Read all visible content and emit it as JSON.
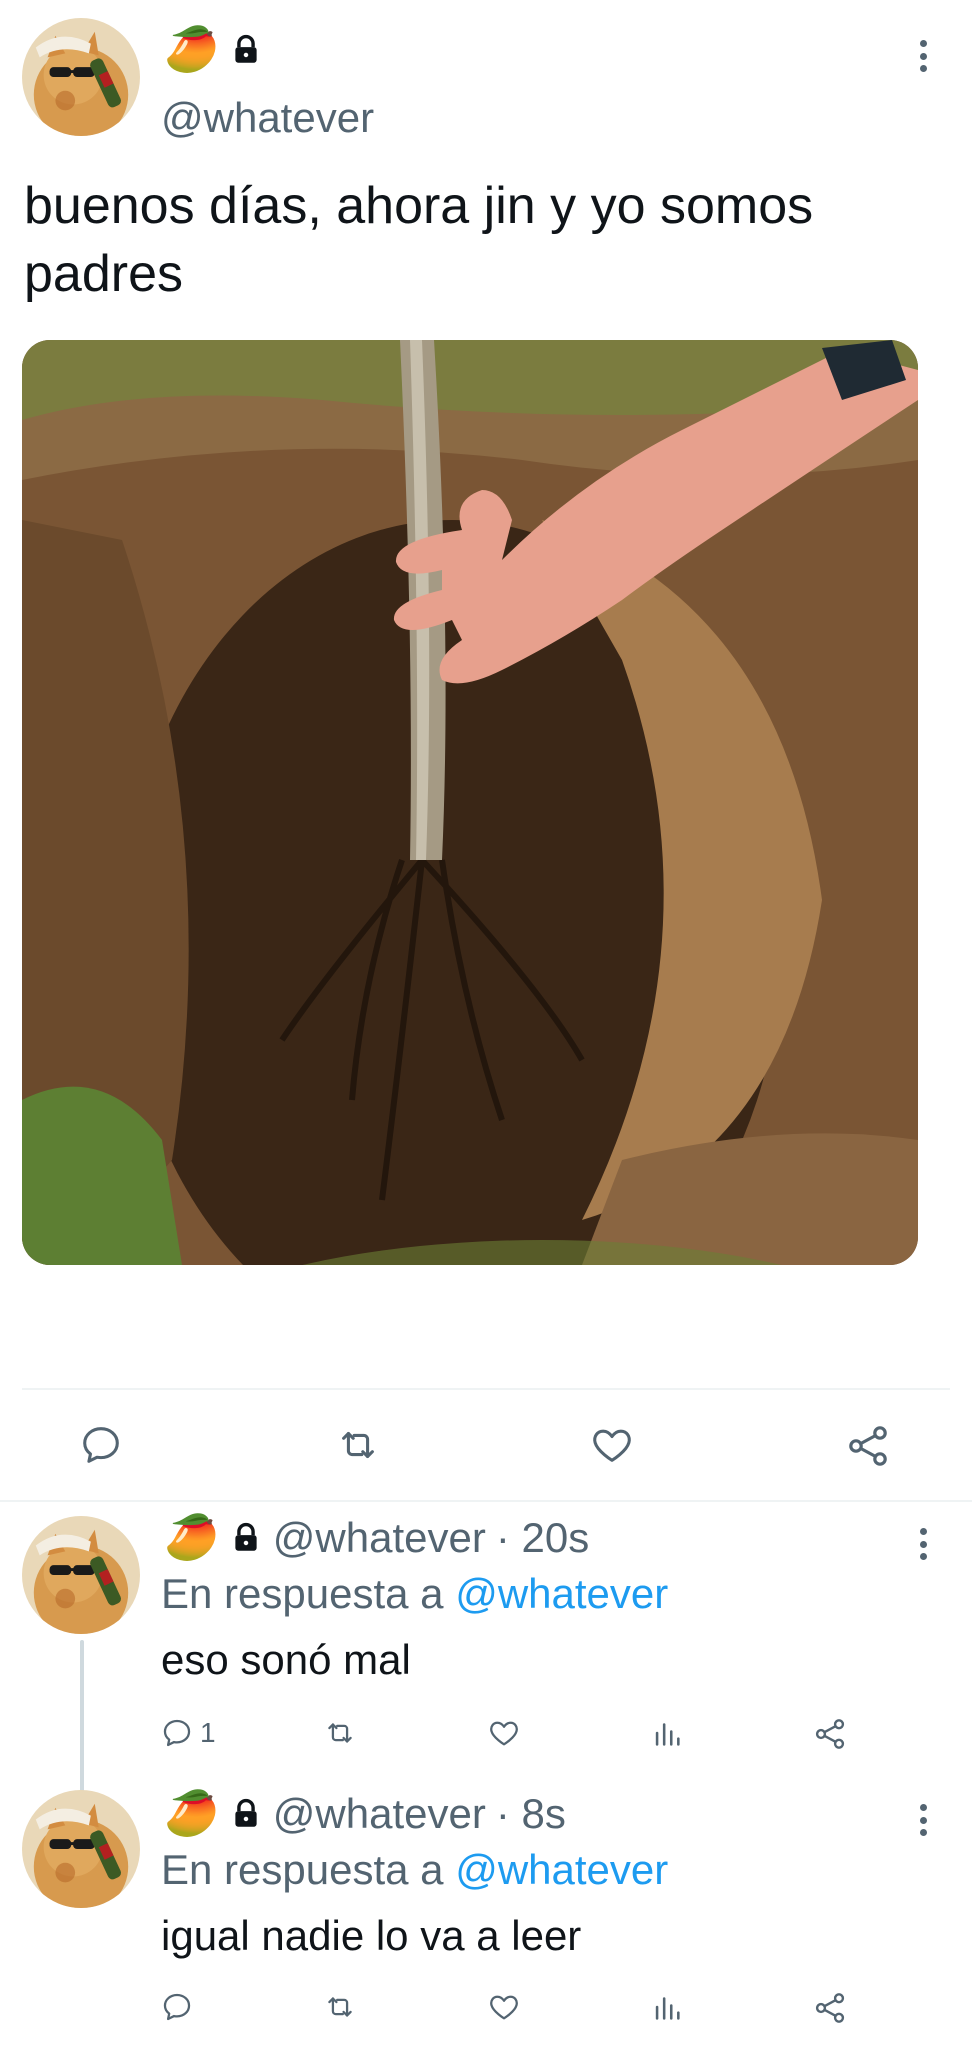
{
  "main_post": {
    "emoji": "🥭",
    "handle": "@whatever",
    "text": "buenos días, ahora jin y yo somos padres"
  },
  "replies": [
    {
      "emoji": "🥭",
      "handle": "@whatever",
      "time": "· 20s",
      "reply_to_label": "En respuesta a",
      "reply_to_handle": "@whatever",
      "text": "eso sonó mal",
      "reply_count": "1"
    },
    {
      "emoji": "🥭",
      "handle": "@whatever",
      "time": "· 8s",
      "reply_to_label": "En respuesta a",
      "reply_to_handle": "@whatever",
      "text": "igual nadie lo va a leer",
      "reply_count": ""
    }
  ],
  "colors": {
    "accent": "#1d9bf0",
    "muted": "#536471"
  },
  "icons": [
    "more-icon",
    "lock-icon",
    "reply-icon",
    "retweet-icon",
    "like-icon",
    "share-icon",
    "views-icon"
  ]
}
